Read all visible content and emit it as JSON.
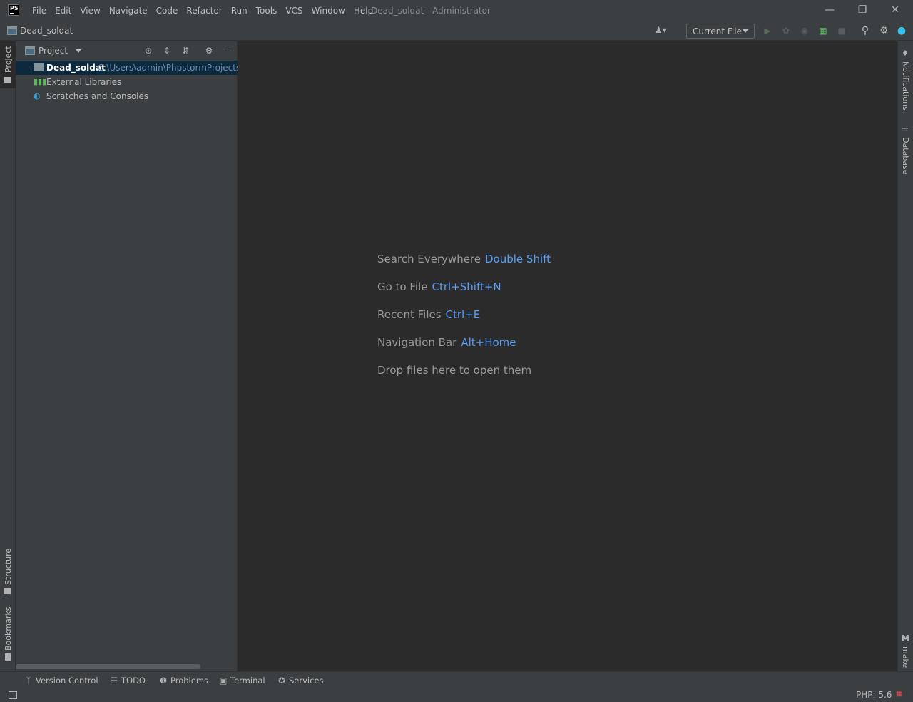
{
  "app": {
    "logo_text": "PS",
    "window_title": "Dead_soldat - Administrator"
  },
  "menu": [
    "File",
    "Edit",
    "View",
    "Navigate",
    "Code",
    "Refactor",
    "Run",
    "Tools",
    "VCS",
    "Window",
    "Help"
  ],
  "navbar": {
    "project_name": "Dead_soldat",
    "run_config": "Current File"
  },
  "left_stripe": {
    "project": "Project",
    "structure": "Structure",
    "bookmarks": "Bookmarks"
  },
  "right_stripe": {
    "notifications": "Notifications",
    "database": "Database",
    "make": "make"
  },
  "project_panel": {
    "title": "Project",
    "tree": [
      {
        "label": "Dead_soldat",
        "path": "C:\\Users\\admin\\PhpstormProjects\\D",
        "selected": true,
        "icon": "folder-icon"
      },
      {
        "label": "External Libraries",
        "icon": "library-icon"
      },
      {
        "label": "Scratches and Consoles",
        "icon": "scratches-icon"
      }
    ]
  },
  "editor_hints": [
    {
      "label": "Search Everywhere",
      "key": "Double Shift"
    },
    {
      "label": "Go to File",
      "key": "Ctrl+Shift+N"
    },
    {
      "label": "Recent Files",
      "key": "Ctrl+E"
    },
    {
      "label": "Navigation Bar",
      "key": "Alt+Home"
    },
    {
      "label": "Drop files here to open them",
      "key": ""
    }
  ],
  "bottom_tools": [
    {
      "label": "Version Control",
      "icon": "branch-icon"
    },
    {
      "label": "TODO",
      "icon": "list-icon"
    },
    {
      "label": "Problems",
      "icon": "problems-icon"
    },
    {
      "label": "Terminal",
      "icon": "terminal-icon"
    },
    {
      "label": "Services",
      "icon": "services-icon"
    }
  ],
  "status": {
    "php_version": "PHP: 5.6"
  },
  "colors": {
    "editor_bg": "#2b2b2b",
    "panel_bg": "#3c3f41",
    "selection": "#0d293e",
    "shortcut": "#589df6",
    "path": "#6a8cae"
  }
}
